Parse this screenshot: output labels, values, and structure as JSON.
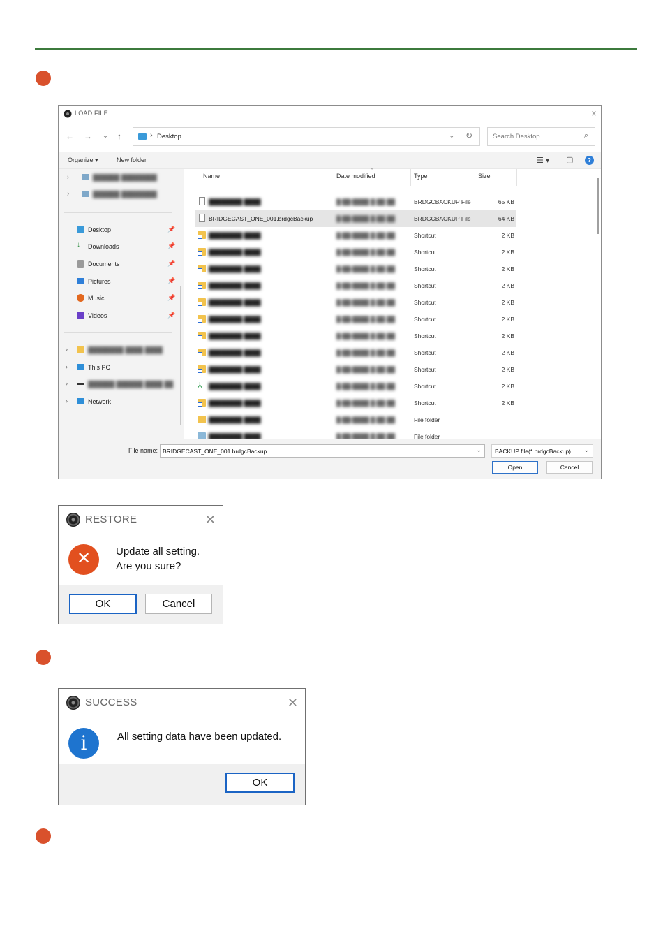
{
  "load_dialog": {
    "title": "LOAD FILE",
    "close": "×",
    "nav": {
      "back": "←",
      "forward": "→",
      "recent": "⌄",
      "up": "↑"
    },
    "address": {
      "separator": "›",
      "path": "Desktop",
      "dropdown": "⌄",
      "refresh": "↻"
    },
    "search": {
      "placeholder": "Search Desktop",
      "icon": "⌕"
    },
    "toolbar": {
      "organize": "Organize ▾",
      "new_folder": "New folder",
      "view_icon": "☰ ▾",
      "pane_icon": "▢",
      "help_icon": "?"
    },
    "sidebar": {
      "quick_access": [
        {
          "label": "Desktop",
          "icon": "desktop-icon",
          "color": "#3a9ad9",
          "pin": "📌"
        },
        {
          "label": "Downloads",
          "icon": "downloads-icon",
          "color": "#2b8a3e",
          "pin": "📌"
        },
        {
          "label": "Documents",
          "icon": "documents-icon",
          "color": "#8a8a8a",
          "pin": "📌"
        },
        {
          "label": "Pictures",
          "icon": "pictures-icon",
          "color": "#2f7fd8",
          "pin": "📌"
        },
        {
          "label": "Music",
          "icon": "music-icon",
          "color": "#e2681f",
          "pin": "📌"
        },
        {
          "label": "Videos",
          "icon": "videos-icon",
          "color": "#6a3fc8",
          "pin": "📌"
        }
      ],
      "locations": [
        {
          "label": "This PC",
          "icon": "this-pc-icon",
          "color": "#2f8fd8"
        },
        {
          "label": "Network",
          "icon": "network-icon",
          "color": "#2f8fd8"
        }
      ]
    },
    "columns": {
      "name": "Name",
      "date": "Date modified",
      "type": "Type",
      "size": "Size",
      "sort_caret": "⌃"
    },
    "files": [
      {
        "name": "",
        "date": "",
        "type": "BRDGCBACKUP File",
        "size": "65 KB",
        "icon": "file"
      },
      {
        "name": "BRIDGECAST_ONE_001.brdgcBackup",
        "date": "",
        "type": "BRDGCBACKUP File",
        "size": "64 KB",
        "icon": "file",
        "selected": true
      },
      {
        "name": "",
        "date": "",
        "type": "Shortcut",
        "size": "2 KB",
        "icon": "shortcut"
      },
      {
        "name": "",
        "date": "",
        "type": "Shortcut",
        "size": "2 KB",
        "icon": "shortcut"
      },
      {
        "name": "",
        "date": "",
        "type": "Shortcut",
        "size": "2 KB",
        "icon": "shortcut"
      },
      {
        "name": "",
        "date": "",
        "type": "Shortcut",
        "size": "2 KB",
        "icon": "shortcut"
      },
      {
        "name": "",
        "date": "",
        "type": "Shortcut",
        "size": "2 KB",
        "icon": "shortcut"
      },
      {
        "name": "",
        "date": "",
        "type": "Shortcut",
        "size": "2 KB",
        "icon": "shortcut"
      },
      {
        "name": "",
        "date": "",
        "type": "Shortcut",
        "size": "2 KB",
        "icon": "shortcut"
      },
      {
        "name": "",
        "date": "",
        "type": "Shortcut",
        "size": "2 KB",
        "icon": "shortcut"
      },
      {
        "name": "",
        "date": "",
        "type": "Shortcut",
        "size": "2 KB",
        "icon": "shortcut"
      },
      {
        "name": "",
        "date": "",
        "type": "Shortcut",
        "size": "2 KB",
        "icon": "app"
      },
      {
        "name": "",
        "date": "",
        "type": "Shortcut",
        "size": "2 KB",
        "icon": "shortcut"
      },
      {
        "name": "",
        "date": "",
        "type": "File folder",
        "size": "",
        "icon": "folder"
      },
      {
        "name": "",
        "date": "",
        "type": "File folder",
        "size": "",
        "icon": "protected"
      }
    ],
    "filename_label": "File name:",
    "filename_value": "BRIDGECAST_ONE_001.brdgcBackup",
    "filetype_value": "BACKUP file(*.brdgcBackup)",
    "dropdown_glyph": "⌄",
    "open_label": "Open",
    "cancel_label": "Cancel"
  },
  "restore_dialog": {
    "title": "RESTORE",
    "close": "✕",
    "icon_glyph": "✕",
    "message_line1": "Update all setting.",
    "message_line2": "Are you sure?",
    "ok_label": "OK",
    "cancel_label": "Cancel"
  },
  "success_dialog": {
    "title": "SUCCESS",
    "close": "✕",
    "icon_glyph": "i",
    "message": "All setting data have been updated.",
    "ok_label": "OK"
  },
  "colors": {
    "accent_line": "#3c7a3c",
    "step_dot": "#d9512c",
    "error": "#e2501f",
    "info": "#1e74cf",
    "primary_border": "#1b64c4"
  }
}
